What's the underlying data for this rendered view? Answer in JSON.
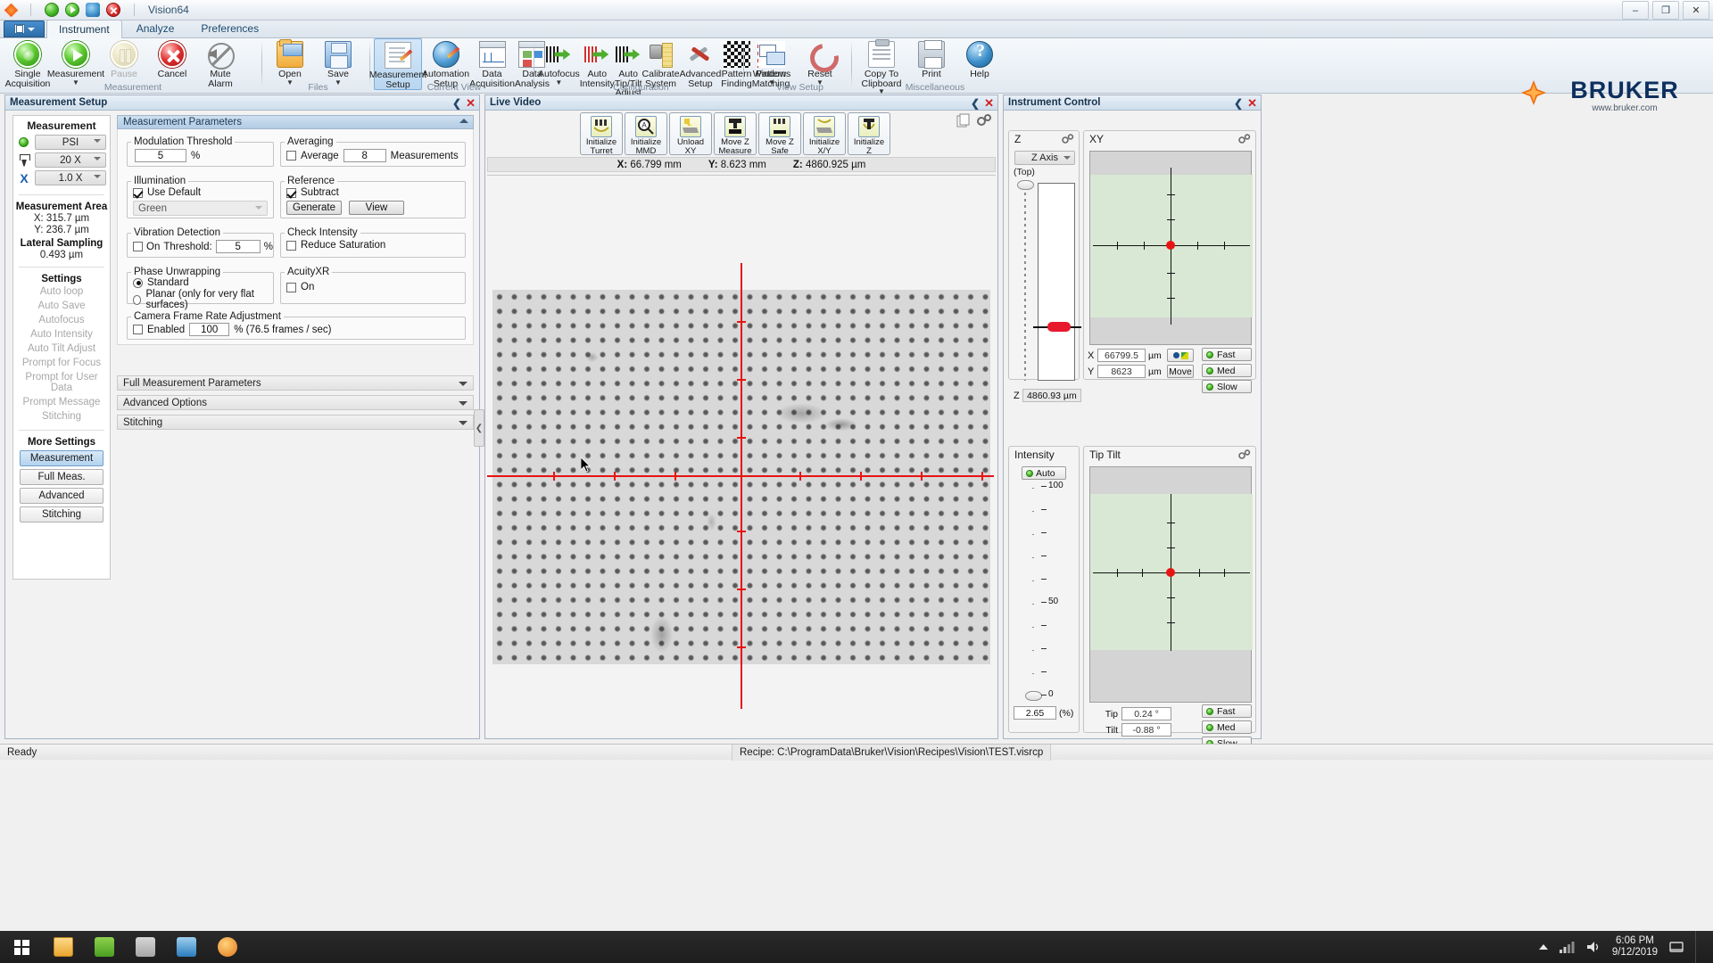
{
  "window": {
    "title": "Vision64",
    "quick_access": [
      "bruker-icon",
      "single-acquisition-icon",
      "measurement-icon",
      "settings-icon",
      "cancel-icon"
    ],
    "controls": {
      "minimize": "–",
      "maximize": "❐",
      "close": "✕"
    }
  },
  "ribbon": {
    "app_button": "file-menu",
    "tabs": [
      {
        "label": "Instrument",
        "active": true
      },
      {
        "label": "Analyze",
        "active": false
      },
      {
        "label": "Preferences",
        "active": false
      }
    ],
    "groups": [
      {
        "name": "Measurement",
        "items": [
          {
            "label": "Single\nAcquisition",
            "icon": "single-acquisition-icon",
            "disabled": false,
            "dropdown": false
          },
          {
            "label": "Measurement",
            "icon": "measurement-play-icon",
            "disabled": false,
            "dropdown": true
          },
          {
            "label": "Pause",
            "icon": "pause-icon",
            "disabled": true,
            "dropdown": false
          },
          {
            "label": "Cancel",
            "icon": "cancel-icon",
            "disabled": false,
            "dropdown": false
          },
          {
            "label": "Mute\nAlarm",
            "icon": "mute-alarm-icon",
            "disabled": false,
            "dropdown": false
          }
        ]
      },
      {
        "name": "Files",
        "items": [
          {
            "label": "Open",
            "icon": "open-folder-icon",
            "disabled": false,
            "dropdown": true
          },
          {
            "label": "Save",
            "icon": "save-disk-icon",
            "disabled": false,
            "dropdown": true
          }
        ]
      },
      {
        "name": "Current View",
        "items": [
          {
            "label": "Measurement\nSetup",
            "icon": "measurement-setup-icon",
            "disabled": false,
            "dropdown": false,
            "selected": true
          },
          {
            "label": "Automation\nSetup",
            "icon": "automation-setup-icon",
            "disabled": false,
            "dropdown": false
          },
          {
            "label": "Data\nAcquisition",
            "icon": "data-acquisition-icon",
            "disabled": false,
            "dropdown": false
          },
          {
            "label": "Data\nAnalysis",
            "icon": "data-analysis-icon",
            "disabled": false,
            "dropdown": false
          }
        ]
      },
      {
        "name": "Configuration",
        "items": [
          {
            "label": "Autofocus",
            "icon": "autofocus-icon",
            "disabled": false,
            "dropdown": true
          },
          {
            "label": "Auto\nIntensity",
            "icon": "auto-intensity-icon",
            "disabled": false,
            "dropdown": true
          },
          {
            "label": "Auto Tip/Tilt\nAdjust",
            "icon": "auto-tiptilt-icon",
            "disabled": false,
            "dropdown": true
          },
          {
            "label": "Calibrate\nSystem",
            "icon": "calibrate-system-icon",
            "disabled": false,
            "dropdown": false
          },
          {
            "label": "Advanced\nSetup",
            "icon": "advanced-setup-icon",
            "disabled": false,
            "dropdown": false
          },
          {
            "label": "Pattern\nFinding",
            "icon": "pattern-finding-icon",
            "disabled": false,
            "dropdown": false
          },
          {
            "label": "Pattern\nMatching",
            "icon": "pattern-matching-icon",
            "disabled": false,
            "dropdown": false
          }
        ]
      },
      {
        "name": "View Setup",
        "items": [
          {
            "label": "Windows",
            "icon": "windows-icon",
            "disabled": false,
            "dropdown": true
          },
          {
            "label": "Reset",
            "icon": "reset-icon",
            "disabled": false,
            "dropdown": true
          }
        ]
      },
      {
        "name": "Miscellaneous",
        "items": [
          {
            "label": "Copy To\nClipboard",
            "icon": "clipboard-icon",
            "disabled": false,
            "dropdown": true
          },
          {
            "label": "Print",
            "icon": "print-icon",
            "disabled": false,
            "dropdown": false
          },
          {
            "label": "Help",
            "icon": "help-icon",
            "disabled": false,
            "dropdown": false
          }
        ]
      }
    ],
    "brand": {
      "name": "BRUKER",
      "url": "www.bruker.com"
    }
  },
  "measurement_setup": {
    "panel_title": "Measurement Setup",
    "left": {
      "heading": "Measurement",
      "selects": [
        {
          "icon": "green-status-dot",
          "value": "PSI"
        },
        {
          "icon": "objective-icon",
          "value": "20 X"
        },
        {
          "icon": "zoom-x-icon",
          "value": "1.0 X"
        }
      ],
      "measurement_area_title": "Measurement Area",
      "measurement_area_x": "X: 315.7 µm",
      "measurement_area_y": "Y: 236.7 µm",
      "lateral_sampling_title": "Lateral Sampling",
      "lateral_sampling_value": "0.493 µm",
      "settings_title": "Settings",
      "settings_items": [
        "Auto loop",
        "Auto Save",
        "Autofocus",
        "Auto Intensity",
        "Auto Tilt Adjust",
        "Prompt for Focus",
        "Prompt for User Data",
        "Prompt Message",
        "Stitching"
      ],
      "more_settings_title": "More Settings",
      "more_settings_buttons": [
        {
          "label": "Measurement",
          "active": true
        },
        {
          "label": "Full Meas.",
          "active": false
        },
        {
          "label": "Advanced",
          "active": false
        },
        {
          "label": "Stitching",
          "active": false
        }
      ]
    },
    "parameters": {
      "header": "Measurement Parameters",
      "modulation_threshold": {
        "legend": "Modulation Threshold",
        "value": "5",
        "unit": "%"
      },
      "averaging": {
        "legend": "Averaging",
        "checkbox_label": "Average",
        "checked": false,
        "value": "8",
        "suffix": "Measurements"
      },
      "illumination": {
        "legend": "Illumination",
        "use_default_label": "Use Default",
        "use_default_checked": true,
        "color": "Green"
      },
      "reference": {
        "legend": "Reference",
        "subtract_label": "Subtract",
        "subtract_checked": true,
        "generate_button": "Generate",
        "view_button": "View"
      },
      "vibration_detection": {
        "legend": "Vibration Detection",
        "on_label": "On",
        "on_checked": false,
        "threshold_label": "Threshold:",
        "threshold_value": "5",
        "unit": "%"
      },
      "check_intensity": {
        "legend": "Check Intensity",
        "reduce_saturation_label": "Reduce Saturation",
        "reduce_saturation_checked": false
      },
      "phase_unwrapping": {
        "legend": "Phase Unwrapping",
        "option_standard": "Standard",
        "option_planar": "Planar (only for very flat surfaces)",
        "selected": "Standard"
      },
      "acuityxr": {
        "legend": "AcuityXR",
        "on_label": "On",
        "on_checked": false
      },
      "camera_frame_rate": {
        "legend": "Camera Frame Rate Adjustment",
        "enabled_label": "Enabled",
        "enabled_checked": false,
        "value": "100",
        "suffix": "% (76.5 frames / sec)"
      },
      "collapsed_sections": [
        "Full Measurement Parameters",
        "Advanced Options",
        "Stitching"
      ]
    }
  },
  "live_video": {
    "panel_title": "Live Video",
    "buttons": [
      {
        "label": "Initialize\nTurret",
        "icon": "initialize-turret-icon"
      },
      {
        "label": "Initialize\nMMD",
        "icon": "initialize-mmd-icon"
      },
      {
        "label": "Unload\nXY",
        "icon": "unload-xy-icon"
      },
      {
        "label": "Move Z\nMeasure",
        "icon": "move-z-measure-icon"
      },
      {
        "label": "Move Z\nSafe",
        "icon": "move-z-safe-icon"
      },
      {
        "label": "Initialize\nX/Y",
        "icon": "initialize-xy-icon"
      },
      {
        "label": "Initialize\nZ",
        "icon": "initialize-z-icon"
      }
    ],
    "header_tools": [
      "copy-icon",
      "settings-gear-icon"
    ],
    "coordinates": [
      {
        "axis": "X:",
        "value": "66.799 mm"
      },
      {
        "axis": "Y:",
        "value": "8.623 mm"
      },
      {
        "axis": "Z:",
        "value": "4860.925 µm"
      }
    ]
  },
  "instrument_control": {
    "panel_title": "Instrument Control",
    "z": {
      "title": "Z",
      "axis_select": "Z Axis",
      "top_label": "(Top)",
      "readout_label": "Z",
      "readout_value": "4860.93 µm"
    },
    "xy": {
      "title": "XY",
      "x_label": "X",
      "x_value": "66799.5",
      "x_unit": "µm",
      "y_label": "Y",
      "y_value": "8623",
      "y_unit": "µm",
      "move_button": "Move",
      "speeds": [
        {
          "label": "Fast"
        },
        {
          "label": "Med"
        },
        {
          "label": "Slow"
        }
      ]
    },
    "intensity": {
      "title": "Intensity",
      "auto_label": "Auto",
      "auto_on": true,
      "scale_labels": [
        {
          "value": "100",
          "pos": 4
        },
        {
          "value": "50",
          "pos": 55
        }
      ],
      "zero_label": "0",
      "value": "2.65",
      "unit": "(%)"
    },
    "tiptilt": {
      "title": "Tip Tilt",
      "tip_label": "Tip",
      "tip_value": "0.24 °",
      "tilt_label": "Tilt",
      "tilt_value": "-0.88 °",
      "speeds": [
        {
          "label": "Fast"
        },
        {
          "label": "Med"
        },
        {
          "label": "Slow"
        }
      ]
    }
  },
  "status_bar": {
    "status": "Ready",
    "recipe": "Recipe: C:\\ProgramData\\Bruker\\Vision\\Recipes\\Vision\\TEST.visrcp"
  },
  "taskbar": {
    "start": "start-button",
    "items": [
      "file-explorer-icon",
      "app-green-icon",
      "media-player-icon",
      "app-blue-icon",
      "app-orange-icon"
    ],
    "tray": {
      "time": "6:06 PM",
      "date": "9/12/2019",
      "show_hidden": "show-hidden-icons",
      "notification": "notification-icon"
    }
  }
}
